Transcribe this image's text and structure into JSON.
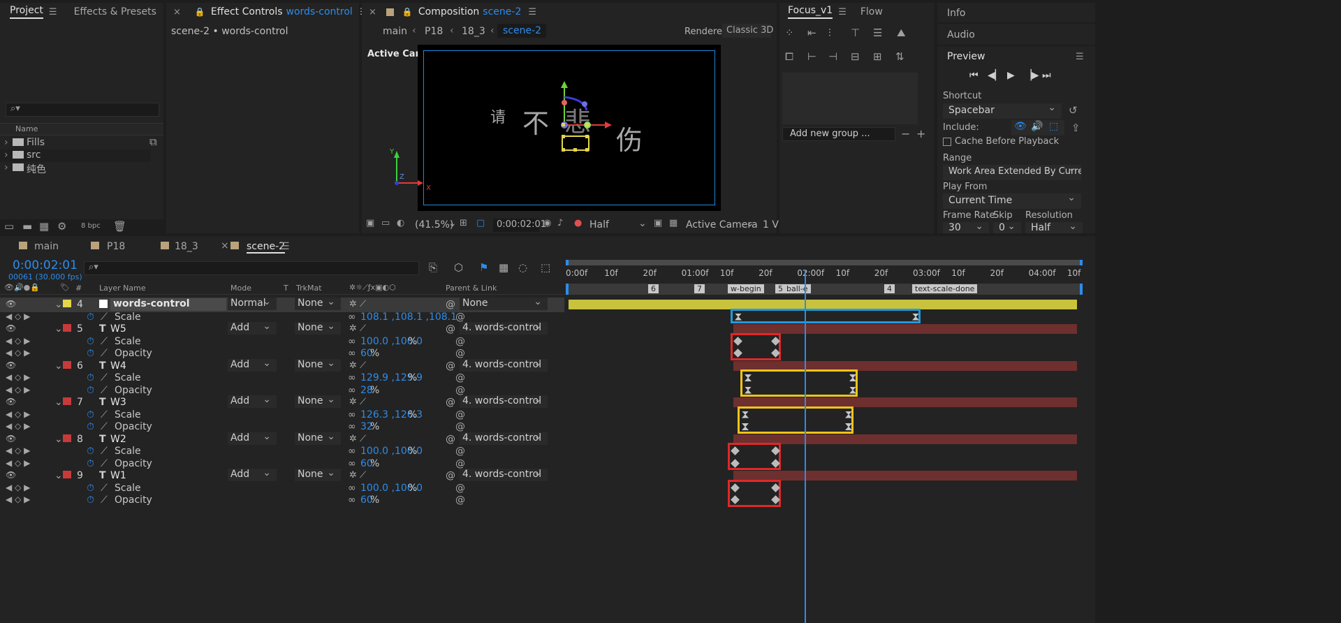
{
  "project_panel": {
    "tabs": [
      "Project",
      "Effects & Presets"
    ],
    "search_placeholder": "",
    "name_header": "Name",
    "items": [
      "Fills",
      "src",
      "纯色"
    ],
    "bpc": "8 bpc"
  },
  "effect_controls": {
    "title": "Effect Controls",
    "layer": "words-control",
    "breadcrumb": "scene-2 • words-control"
  },
  "composition": {
    "title": "Composition",
    "comp": "scene-2",
    "breadcrumbs": [
      "main",
      "P18",
      "18_3",
      "scene-2"
    ],
    "renderer_label": "Renderer:",
    "renderer": "Classic 3D",
    "view_label": "Active Camera",
    "zoom": "(41.5%)",
    "timecode": "0:00:02:01",
    "resolution": "Half",
    "camera": "Active Camera",
    "views": "1 V",
    "text_chars": [
      "请",
      "不",
      "悲",
      "伤"
    ],
    "axis": [
      "Y",
      "Z",
      "X"
    ]
  },
  "focus_panel": {
    "tabs": [
      "Focus_v1",
      "Flow"
    ],
    "add_group_placeholder": "Add new group ..."
  },
  "right_panel": {
    "info": "Info",
    "audio": "Audio",
    "preview": "Preview",
    "shortcut_label": "Shortcut",
    "shortcut": "Spacebar",
    "include_label": "Include:",
    "cache": "Cache Before Playback",
    "range_label": "Range",
    "range": "Work Area Extended By Current...",
    "play_from_label": "Play From",
    "play_from": "Current Time",
    "frame_rate_label": "Frame Rate",
    "skip_label": "Skip",
    "resolution_label": "Resolution",
    "frame_rate": "30",
    "skip": "0",
    "resolution": "Half"
  },
  "timeline": {
    "tabs": [
      "main",
      "P18",
      "18_3",
      "scene-2"
    ],
    "timecode": "0:00:02:01",
    "fps": "00061 (30.000 fps)",
    "columns": {
      "num": "#",
      "layer_name": "Layer Name",
      "mode": "Mode",
      "t": "T",
      "trkmat": "TrkMat",
      "parent": "Parent & Link"
    },
    "ruler": [
      "0:00f",
      "10f",
      "20f",
      "01:00f",
      "10f",
      "20f",
      "02:00f",
      "10f",
      "20f",
      "03:00f",
      "10f",
      "20f",
      "04:00f",
      "10f"
    ],
    "markers": [
      "6",
      "7",
      "w-begin",
      "5",
      "ball-e",
      "4",
      "text-scale-done"
    ],
    "current_time_fraction": 0.462,
    "layers": [
      {
        "num": "4",
        "type": "",
        "name": "words-control",
        "mode": "Normal",
        "trkmat": "None",
        "parent": "None",
        "color": "#e5d54c",
        "props": [
          {
            "name": "Scale",
            "value": "108.1 ,108.1 ,108.1",
            "unit": ""
          }
        ]
      },
      {
        "num": "5",
        "type": "T",
        "name": "W5",
        "mode": "Add",
        "trkmat": "None",
        "parent": "4. words-control",
        "color": "#c83a3a",
        "props": [
          {
            "name": "Scale",
            "value": "100.0 ,100.0",
            "unit": "%"
          },
          {
            "name": "Opacity",
            "value": "60",
            "unit": "%"
          }
        ]
      },
      {
        "num": "6",
        "type": "T",
        "name": "W4",
        "mode": "Add",
        "trkmat": "None",
        "parent": "4. words-control",
        "color": "#c83a3a",
        "props": [
          {
            "name": "Scale",
            "value": "129.9 ,129.9",
            "unit": "%"
          },
          {
            "name": "Opacity",
            "value": "28",
            "unit": "%"
          }
        ]
      },
      {
        "num": "7",
        "type": "T",
        "name": "W3",
        "mode": "Add",
        "trkmat": "None",
        "parent": "4. words-control",
        "color": "#c83a3a",
        "props": [
          {
            "name": "Scale",
            "value": "126.3 ,126.3",
            "unit": "%"
          },
          {
            "name": "Opacity",
            "value": "32",
            "unit": "%"
          }
        ]
      },
      {
        "num": "8",
        "type": "T",
        "name": "W2",
        "mode": "Add",
        "trkmat": "None",
        "parent": "4. words-control",
        "color": "#c83a3a",
        "props": [
          {
            "name": "Scale",
            "value": "100.0 ,100.0",
            "unit": "%"
          },
          {
            "name": "Opacity",
            "value": "60",
            "unit": "%"
          }
        ]
      },
      {
        "num": "9",
        "type": "T",
        "name": "W1",
        "mode": "Add",
        "trkmat": "None",
        "parent": "4. words-control",
        "color": "#c83a3a",
        "props": [
          {
            "name": "Scale",
            "value": "100.0 ,100.0",
            "unit": "%"
          },
          {
            "name": "Opacity",
            "value": "60",
            "unit": "%"
          }
        ]
      }
    ]
  },
  "colors": {
    "accent": "#2d8ceb",
    "label_yellow": "#e5d54c",
    "label_red": "#c83a3a",
    "bar_yellow": "#c9c23d",
    "bar_red": "#6e2f2f",
    "highlight_blue": "#1f9be0",
    "highlight_red": "#e02828",
    "highlight_yellow": "#f0c419"
  }
}
